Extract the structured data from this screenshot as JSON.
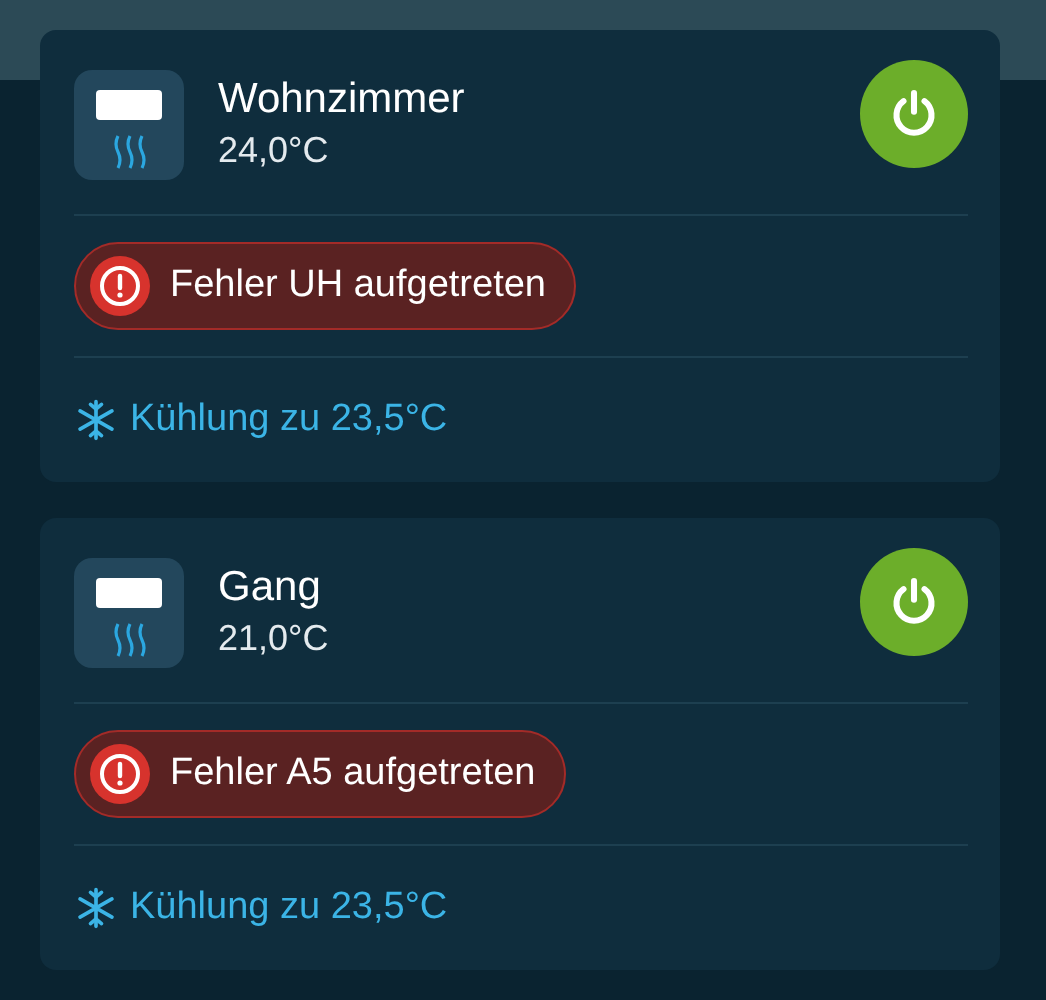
{
  "devices": [
    {
      "name": "Wohnzimmer",
      "temperature": "24,0°C",
      "on": true,
      "error": "Fehler UH aufgetreten",
      "mode": "Kühlung zu 23,5°C"
    },
    {
      "name": "Gang",
      "temperature": "21,0°C",
      "on": true,
      "error": "Fehler A5 aufgetreten",
      "mode": "Kühlung zu 23,5°C"
    }
  ]
}
